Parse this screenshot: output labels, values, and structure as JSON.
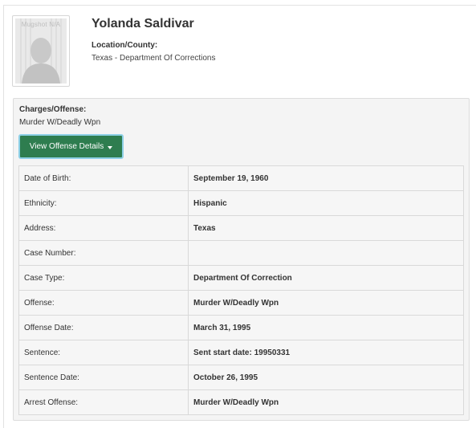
{
  "profile": {
    "mugshot_caption": "Mugshot N/A",
    "name": "Yolanda Saldivar",
    "location_label": "Location/County:",
    "location_value": "Texas - Department Of Corrections"
  },
  "charges": {
    "label": "Charges/Offense:",
    "value": "Murder W/Deadly Wpn",
    "button_label": "View Offense Details"
  },
  "details": [
    {
      "key": "Date of Birth:",
      "value": "September 19, 1960"
    },
    {
      "key": "Ethnicity:",
      "value": "Hispanic"
    },
    {
      "key": "Address:",
      "value": "Texas"
    },
    {
      "key": "Case Number:",
      "value": ""
    },
    {
      "key": "Case Type:",
      "value": "Department Of Correction"
    },
    {
      "key": "Offense:",
      "value": "Murder W/Deadly Wpn"
    },
    {
      "key": "Offense Date:",
      "value": "March 31, 1995"
    },
    {
      "key": "Sentence:",
      "value": "Sent start date: 19950331"
    },
    {
      "key": "Sentence Date:",
      "value": "October 26, 1995"
    },
    {
      "key": "Arrest Offense:",
      "value": "Murder W/Deadly Wpn"
    }
  ],
  "colors": {
    "button_bg": "#2e7d4f",
    "button_focus_ring": "#8dd0e6",
    "panel_bg": "#f4f4f4"
  },
  "icons": {
    "mugshot": "person-silhouette-icon",
    "dropdown": "caret-down-icon"
  }
}
